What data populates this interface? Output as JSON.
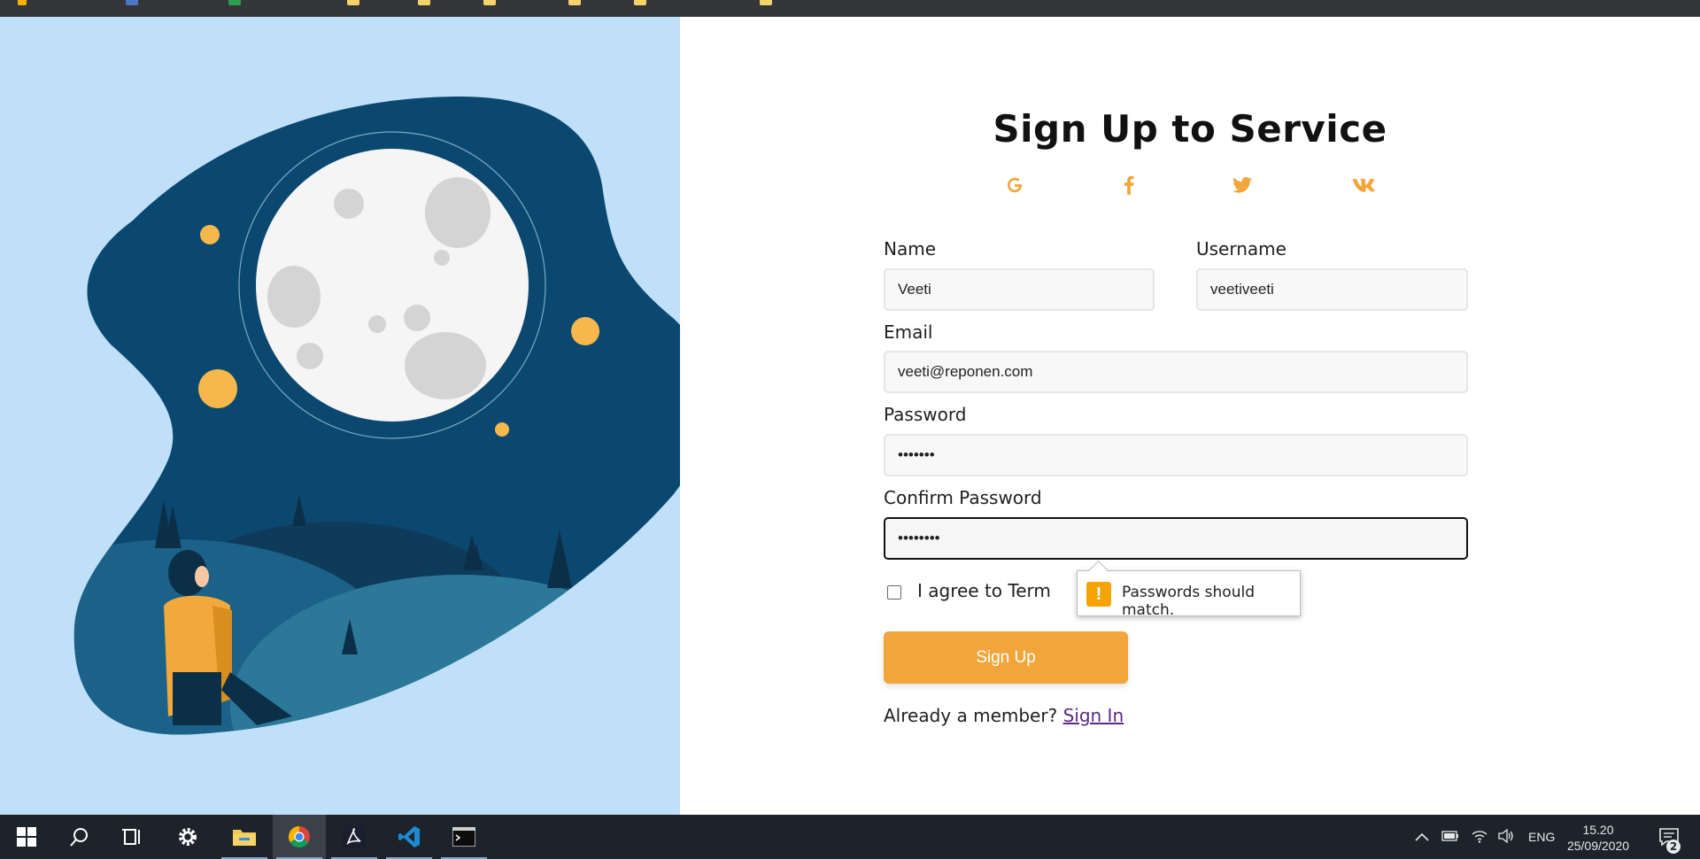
{
  "form": {
    "title": "Sign Up to Service",
    "social": [
      {
        "name": "google",
        "icon": "google-icon"
      },
      {
        "name": "facebook",
        "icon": "facebook-icon"
      },
      {
        "name": "twitter",
        "icon": "twitter-icon"
      },
      {
        "name": "vk",
        "icon": "vk-icon"
      }
    ],
    "name_label": "Name",
    "name_value": "Veeti",
    "username_label": "Username",
    "username_value": "veetiveeti",
    "email_label": "Email",
    "email_value": "veeti@reponen.com",
    "password_label": "Password",
    "password_value": "•••••••",
    "confirm_label": "Confirm Password",
    "confirm_value": "••••••••",
    "terms_label": "I agree to Terms and Conditions",
    "validation_message": "Passwords should match.",
    "validation_icon": "!",
    "signup_button": "Sign Up",
    "member_prefix": "Already a member?",
    "signin_link": "Sign In",
    "accent_color": "#f1a53a"
  },
  "taskbar": {
    "language": "ENG",
    "time": "15.20",
    "date": "25/09/2020",
    "notification_count": "2"
  }
}
